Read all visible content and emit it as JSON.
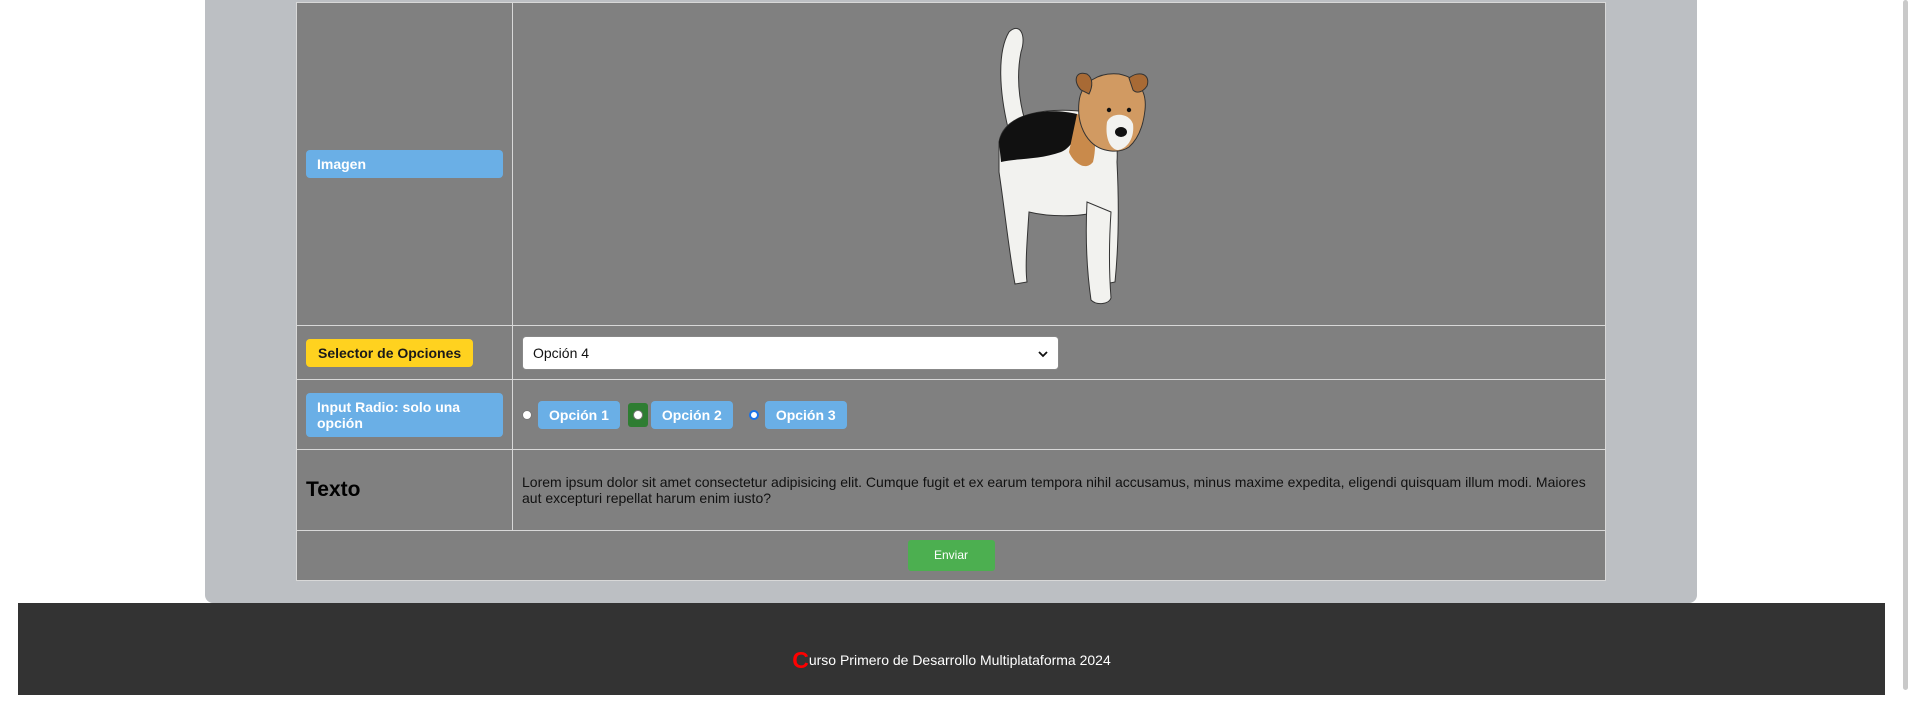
{
  "form": {
    "image_label": "Imagen",
    "select_label": "Selector de Opciones",
    "select_value": "Opción 4",
    "radio_label": "Input Radio: solo una opción",
    "radio_options": [
      "Opción 1",
      "Opción 2",
      "Opción 3"
    ],
    "radio_selected": "Opción 3",
    "text_label": "Texto",
    "text_body": "Lorem ipsum dolor sit amet consectetur adipisicing elit. Cumque fugit et ex earum tempora nihil accusamus, minus maxime expedita, eligendi quisquam illum modi. Maiores aut excepturi repellat harum enim iusto?",
    "submit_label": "Enviar"
  },
  "footer": {
    "first_letter": "C",
    "rest": "urso Primero de Desarrollo Multiplataforma 2024"
  },
  "colors": {
    "pill_blue": "#6aafe6",
    "pill_yellow": "#ffd21f",
    "submit_green": "#4caf50",
    "footer_bg": "#333333",
    "footer_accent": "#ff0000"
  },
  "icons": {
    "select_arrow": "chevron-down-icon",
    "image": "dog-illustration"
  }
}
